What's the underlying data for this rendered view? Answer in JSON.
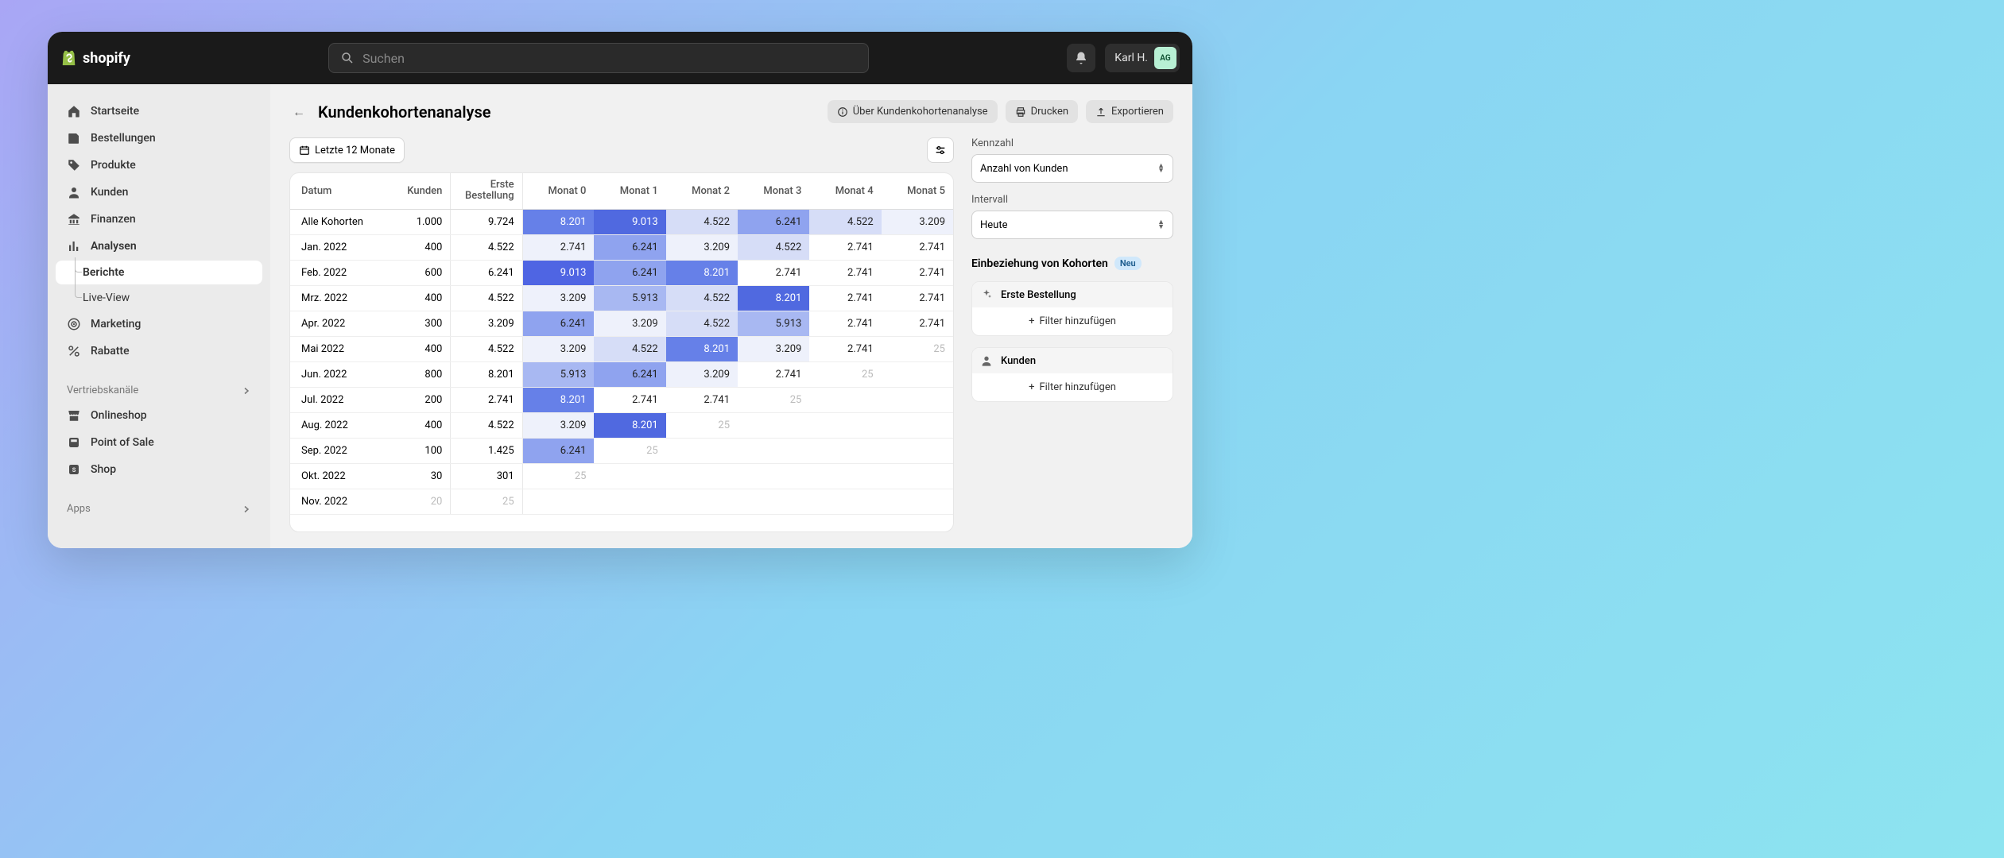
{
  "brand": "shopify",
  "search": {
    "placeholder": "Suchen"
  },
  "user": {
    "name": "Karl H.",
    "initials": "AG"
  },
  "nav": {
    "home": "Startseite",
    "orders": "Bestellungen",
    "products": "Produkte",
    "customers": "Kunden",
    "finance": "Finanzen",
    "analytics": "Analysen",
    "reports": "Berichte",
    "liveview": "Live-View",
    "marketing": "Marketing",
    "discounts": "Rabatte",
    "channels_label": "Vertriebskanäle",
    "onlinestore": "Onlineshop",
    "pos": "Point of Sale",
    "shop": "Shop",
    "apps_label": "Apps"
  },
  "page": {
    "title": "Kundenkohortenanalyse",
    "about": "Über Kundenkohortenanalyse",
    "print": "Drucken",
    "export": "Exportieren",
    "date_range": "Letzte 12 Monate"
  },
  "right": {
    "metric_label": "Kennzahl",
    "metric_value": "Anzahl von Kunden",
    "interval_label": "Intervall",
    "interval_value": "Heute",
    "inclusion_title": "Einbeziehung von Kohorten",
    "badge_new": "Neu",
    "card1_title": "Erste Bestellung",
    "card2_title": "Kunden",
    "add_filter": "Filter hinzufügen"
  },
  "table": {
    "columns": [
      "Datum",
      "Kunden",
      "Erste Bestellung",
      "Monat 0",
      "Monat 1",
      "Monat 2",
      "Monat 3",
      "Monat 4",
      "Monat 5"
    ],
    "rows": [
      {
        "label": "Alle Kohorten",
        "kunden": "1.000",
        "first": "9.724",
        "months": [
          {
            "v": "8.201",
            "c": "#6680e8"
          },
          {
            "v": "9.013",
            "c": "#5069e0"
          },
          {
            "v": "4.522",
            "c": "#d6ddf7"
          },
          {
            "v": "6.241",
            "c": "#8fa3ef"
          },
          {
            "v": "4.522",
            "c": "#d6ddf7"
          },
          {
            "v": "3.209",
            "c": "#eef1fb"
          }
        ]
      },
      {
        "label": "Jan. 2022",
        "kunden": "400",
        "first": "4.522",
        "months": [
          {
            "v": "2.741",
            "c": "#eef1fb"
          },
          {
            "v": "6.241",
            "c": "#8fa3ef"
          },
          {
            "v": "3.209",
            "c": "#eef1fb"
          },
          {
            "v": "4.522",
            "c": "#d6ddf7"
          },
          {
            "v": "2.741",
            "c": ""
          },
          {
            "v": "2.741",
            "c": ""
          }
        ]
      },
      {
        "label": "Feb. 2022",
        "kunden": "600",
        "first": "6.241",
        "months": [
          {
            "v": "9.013",
            "c": "#4f65e3"
          },
          {
            "v": "6.241",
            "c": "#8fa3ef"
          },
          {
            "v": "8.201",
            "c": "#6680e8"
          },
          {
            "v": "2.741",
            "c": ""
          },
          {
            "v": "2.741",
            "c": ""
          },
          {
            "v": "2.741",
            "c": ""
          }
        ]
      },
      {
        "label": "Mrz. 2022",
        "kunden": "400",
        "first": "4.522",
        "months": [
          {
            "v": "3.209",
            "c": "#eef1fb"
          },
          {
            "v": "5.913",
            "c": "#a8b8f2"
          },
          {
            "v": "4.522",
            "c": "#d6ddf7"
          },
          {
            "v": "8.201",
            "c": "#5069e0"
          },
          {
            "v": "2.741",
            "c": ""
          },
          {
            "v": "2.741",
            "c": ""
          }
        ]
      },
      {
        "label": "Apr. 2022",
        "kunden": "300",
        "first": "3.209",
        "months": [
          {
            "v": "6.241",
            "c": "#8fa3ef"
          },
          {
            "v": "3.209",
            "c": "#eef1fb"
          },
          {
            "v": "4.522",
            "c": "#d6ddf7"
          },
          {
            "v": "5.913",
            "c": "#a8b8f2"
          },
          {
            "v": "2.741",
            "c": ""
          },
          {
            "v": "2.741",
            "c": ""
          }
        ]
      },
      {
        "label": "Mai 2022",
        "kunden": "400",
        "first": "4.522",
        "months": [
          {
            "v": "3.209",
            "c": "#eef1fb"
          },
          {
            "v": "4.522",
            "c": "#d6ddf7"
          },
          {
            "v": "8.201",
            "c": "#6680e8"
          },
          {
            "v": "3.209",
            "c": "#eef1fb"
          },
          {
            "v": "2.741",
            "c": ""
          },
          {
            "v": "25",
            "c": "",
            "muted": true
          }
        ]
      },
      {
        "label": "Jun. 2022",
        "kunden": "800",
        "first": "8.201",
        "months": [
          {
            "v": "5.913",
            "c": "#a8b8f2"
          },
          {
            "v": "6.241",
            "c": "#8fa3ef"
          },
          {
            "v": "3.209",
            "c": "#eef1fb"
          },
          {
            "v": "2.741",
            "c": ""
          },
          {
            "v": "25",
            "c": "",
            "muted": true
          },
          {
            "v": "",
            "c": ""
          }
        ]
      },
      {
        "label": "Jul. 2022",
        "kunden": "200",
        "first": "2.741",
        "months": [
          {
            "v": "8.201",
            "c": "#6680e8"
          },
          {
            "v": "2.741",
            "c": ""
          },
          {
            "v": "2.741",
            "c": ""
          },
          {
            "v": "25",
            "c": "",
            "muted": true
          },
          {
            "v": "",
            "c": ""
          },
          {
            "v": "",
            "c": ""
          }
        ]
      },
      {
        "label": "Aug. 2022",
        "kunden": "400",
        "first": "4.522",
        "months": [
          {
            "v": "3.209",
            "c": "#eef1fb"
          },
          {
            "v": "8.201",
            "c": "#5069e0"
          },
          {
            "v": "25",
            "c": "",
            "muted": true
          },
          {
            "v": "",
            "c": ""
          },
          {
            "v": "",
            "c": ""
          },
          {
            "v": "",
            "c": ""
          }
        ]
      },
      {
        "label": "Sep. 2022",
        "kunden": "100",
        "first": "1.425",
        "months": [
          {
            "v": "6.241",
            "c": "#8fa3ef"
          },
          {
            "v": "25",
            "c": "",
            "muted": true
          },
          {
            "v": "",
            "c": ""
          },
          {
            "v": "",
            "c": ""
          },
          {
            "v": "",
            "c": ""
          },
          {
            "v": "",
            "c": ""
          }
        ]
      },
      {
        "label": "Okt. 2022",
        "kunden": "30",
        "first": "301",
        "months": [
          {
            "v": "25",
            "c": "",
            "muted": true
          },
          {
            "v": "",
            "c": ""
          },
          {
            "v": "",
            "c": ""
          },
          {
            "v": "",
            "c": ""
          },
          {
            "v": "",
            "c": ""
          },
          {
            "v": "",
            "c": ""
          }
        ]
      },
      {
        "label": "Nov. 2022",
        "kunden": "20",
        "kunden_muted": true,
        "first": "25",
        "first_muted": true,
        "months": [
          {
            "v": "",
            "c": ""
          },
          {
            "v": "",
            "c": ""
          },
          {
            "v": "",
            "c": ""
          },
          {
            "v": "",
            "c": ""
          },
          {
            "v": "",
            "c": ""
          },
          {
            "v": "",
            "c": ""
          }
        ]
      }
    ]
  }
}
